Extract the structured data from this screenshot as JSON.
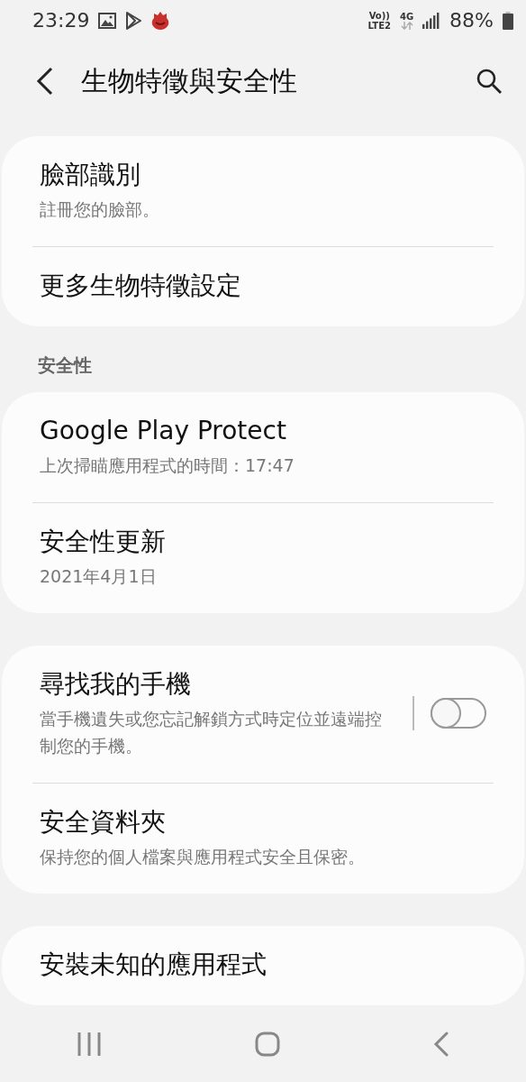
{
  "status_bar": {
    "time": "23:29",
    "volte": "Vo))",
    "lte": "LTE2",
    "network": "4G",
    "battery": "88%"
  },
  "header": {
    "title": "生物特徵與安全性"
  },
  "groups": [
    {
      "items": [
        {
          "kind": "plain",
          "title": "臉部識別",
          "subtitle": "註冊您的臉部。"
        },
        {
          "kind": "plain",
          "title": "更多生物特徵設定"
        }
      ]
    },
    {
      "header": "安全性",
      "items": [
        {
          "kind": "plain",
          "title": "Google Play Protect",
          "subtitle": "上次掃瞄應用程式的時間：17:47"
        },
        {
          "kind": "plain",
          "title": "安全性更新",
          "subtitle": "2021年4月1日"
        }
      ]
    },
    {
      "items": [
        {
          "kind": "switch",
          "title": "尋找我的手機",
          "subtitle": "當手機遺失或您忘記解鎖方式時定位並遠端控制您的手機。",
          "on": false
        },
        {
          "kind": "plain",
          "title": "安全資料夾",
          "subtitle": "保持您的個人檔案與應用程式安全且保密。"
        }
      ]
    },
    {
      "items": [
        {
          "kind": "plain",
          "title": "安裝未知的應用程式"
        }
      ]
    }
  ]
}
